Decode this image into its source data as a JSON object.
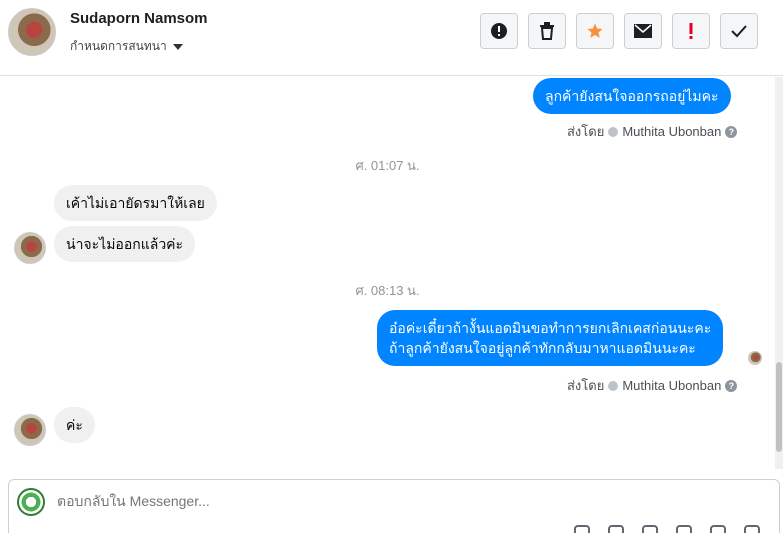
{
  "header": {
    "contact_name": "Sudaporn Namsom",
    "label_select": "กำหนดการสนทนา",
    "actions": [
      {
        "icon": "alert-circle-icon",
        "name": "mark-spam-button"
      },
      {
        "icon": "trash-icon",
        "name": "delete-button"
      },
      {
        "icon": "star-icon",
        "name": "star-button"
      },
      {
        "icon": "envelope-icon",
        "name": "mark-unread-button"
      },
      {
        "icon": "exclamation-icon",
        "name": "follow-up-button"
      },
      {
        "icon": "check-icon",
        "name": "mark-done-button"
      }
    ]
  },
  "messages": {
    "msg1": "ลูกค้ายังสนใจออกรถอยู่ไมคะ",
    "sent_by_1": {
      "prefix": "ส่งโดย",
      "agent": "Muthita Ubonban"
    },
    "time1": "ศ. 01:07 น.",
    "msg2": "เค้าไม่เอายัดรมาให้เลย",
    "msg3": "น่าจะไม่ออกแล้วค่ะ",
    "time2": "ศ. 08:13 น.",
    "msg4_line1": "อ๋อค่ะเดี๋ยวถ้างั้นแอดมินขอทำการยกเลิกเคสก่อนนะคะ",
    "msg4_line2": "ถ้าลูกค้ายังสนใจอยู่ลูกค้าทักกลับมาหาแอดมินนะคะ",
    "sent_by_2": {
      "prefix": "ส่งโดย",
      "agent": "Muthita Ubonban"
    },
    "msg5": "ค่ะ"
  },
  "composer": {
    "placeholder": "ตอบกลับใน Messenger..."
  },
  "colors": {
    "outgoing": "#0084ff",
    "incoming": "#f1f0f0",
    "star": "#f7923a",
    "alert": "#e4002b"
  }
}
